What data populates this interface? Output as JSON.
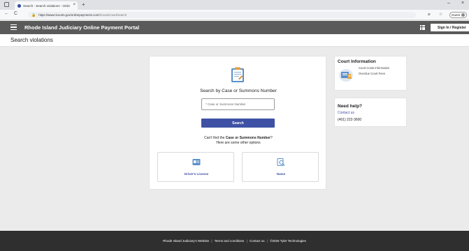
{
  "browser": {
    "tab_title": "Search - Search violations - Onlin",
    "tab_close": "×",
    "new_tab": "+",
    "url_host": "https://www.ricourts.gov/onlinepayments.com",
    "url_path": "/tlcourts/court/search",
    "profile_label": "Guest",
    "min_glyph": "–",
    "close_glyph": "×",
    "back_glyph": "←",
    "reload_glyph": "C",
    "lock_glyph": "🔒"
  },
  "header": {
    "brand": "Rhode Island Judiciary  Online Payment Portal",
    "signin_label": "Sign In / Register"
  },
  "page": {
    "title": "Search violations"
  },
  "search": {
    "heading": "Search by Case or Summons Number",
    "placeholder": "* Case or Summons Number",
    "button_label": "Search",
    "cant_find_prefix": "Can't find the ",
    "cant_find_bold": "Case or Summons Number",
    "cant_find_suffix": "?",
    "other_options": "Here are some other options",
    "options": [
      {
        "label": "Driver's License",
        "icon": "id-card-icon"
      },
      {
        "label": "Name",
        "icon": "person-search-icon"
      }
    ]
  },
  "court_info": {
    "title": "Court Information",
    "links": [
      "Court Costs Information",
      "Overdue Court Fees"
    ]
  },
  "help": {
    "title": "Need help?",
    "contact_label": "Contact us",
    "phone": "(401) 222-3600"
  },
  "footer": {
    "links": [
      "Rhode Island Judiciary's Website",
      "Terms and conditions",
      "Contact us",
      "©2025 Tyler Technologies"
    ],
    "separator": "|"
  },
  "colors": {
    "accent": "#3f51a5",
    "header_bg": "#5a5a5a",
    "footer_bg": "#2f2f2f",
    "page_bg": "#ebebeb"
  }
}
